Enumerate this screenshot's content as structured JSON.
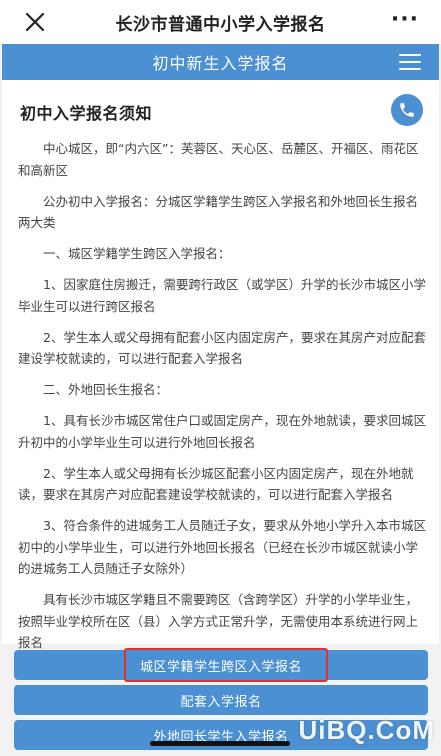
{
  "app": {
    "title": "长沙市普通中小学入学报名",
    "more_label": "···"
  },
  "nav": {
    "title": "初中新生入学报名"
  },
  "notice": {
    "heading": "初中入学报名须知",
    "paragraphs": [
      "中心城区，即“内六区”：芙蓉区、天心区、岳麓区、开福区、雨花区和高新区",
      "公办初中入学报名：分城区学籍学生跨区入学报名和外地回长生报名两大类",
      "一、城区学籍学生跨区入学报名：",
      "1、因家庭住房搬迁，需要跨行政区（或学区）升学的长沙市城区小学毕业生可以进行跨区报名",
      "2、学生本人或父母拥有配套小区内固定房产，要求在其房产对应配套建设学校就读的，可以进行配套入学报名",
      "二、外地回长生报名：",
      "1、具有长沙市城区常住户口或固定房产，现在外地就读，要求回城区升初中的小学毕业生可以进行外地回长报名",
      "2、学生本人或父母拥有长沙城区配套小区内固定房产，现在外地就读，要求在其房产对应配套建设学校就读的，可以进行配套入学报名",
      "3、符合条件的进城务工人员随迁子女，要求从外地小学升入本市城区初中的小学毕业生，可以进行外地回长报名（已经在长沙市城区就读小学的进城务工人员随迁子女除外）",
      "具有长沙市城区学籍且不需要跨区（含跨学区）升学的小学毕业生，按照毕业学校所在区（县）入学方式正常升学，无需使用本系统进行网上报名"
    ]
  },
  "buttons": {
    "cross_district": "城区学籍学生跨区入学报名",
    "supporting": "配套入学报名",
    "outside_return": "外地回长学生入学报名"
  },
  "watermark": "UiBQ.CoM",
  "colors": {
    "primary": "#4b90d2",
    "highlight": "#e53030"
  },
  "icons": [
    "close-icon",
    "more-icon",
    "menu-icon",
    "phone-icon"
  ]
}
